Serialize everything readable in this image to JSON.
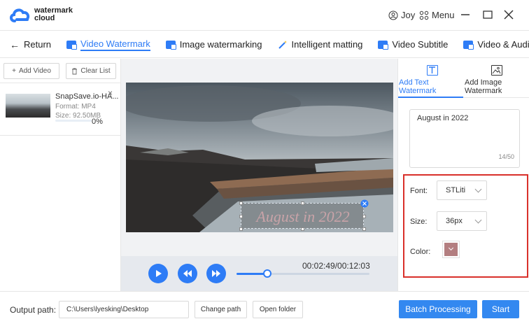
{
  "app": {
    "logo_line1": "watermark",
    "logo_line2": "cloud"
  },
  "header": {
    "user": "Joy",
    "menu": "Menu"
  },
  "tabs": [
    {
      "label": "Return"
    },
    {
      "label": "Video Watermark"
    },
    {
      "label": "Image watermarking"
    },
    {
      "label": "Intelligent matting"
    },
    {
      "label": "Video Subtitle"
    },
    {
      "label": "Video & Audio Sepa"
    }
  ],
  "left": {
    "add_video": "Add Video",
    "clear_list": "Clear List",
    "file": {
      "name": "SnapSave.io-HA...",
      "format": "Format:  MP4",
      "size": "Size:  92.50MB",
      "progress": "0%",
      "progress_value": 0
    }
  },
  "player": {
    "time": "00:02:49/00:12:03",
    "seek_fraction": 0.23,
    "watermark_text": "August in 2022"
  },
  "right": {
    "tab_text": "Add Text Watermark",
    "tab_image": "Add Image Watermark",
    "text_value": "August in 2022",
    "char_count": "14/50",
    "font_label": "Font:",
    "font_value": "STLiti",
    "size_label": "Size:",
    "size_value": "36px",
    "color_label": "Color:",
    "color_hex": "#b37e80"
  },
  "bottom": {
    "output_label": "Output path:",
    "output_path": "C:\\Users\\lyesking\\Desktop",
    "change_path": "Change path",
    "open_folder": "Open folder",
    "batch": "Batch Processing",
    "start": "Start"
  },
  "colors": {
    "accent": "#2e7cf6",
    "highlight_border": "#d9302a"
  }
}
